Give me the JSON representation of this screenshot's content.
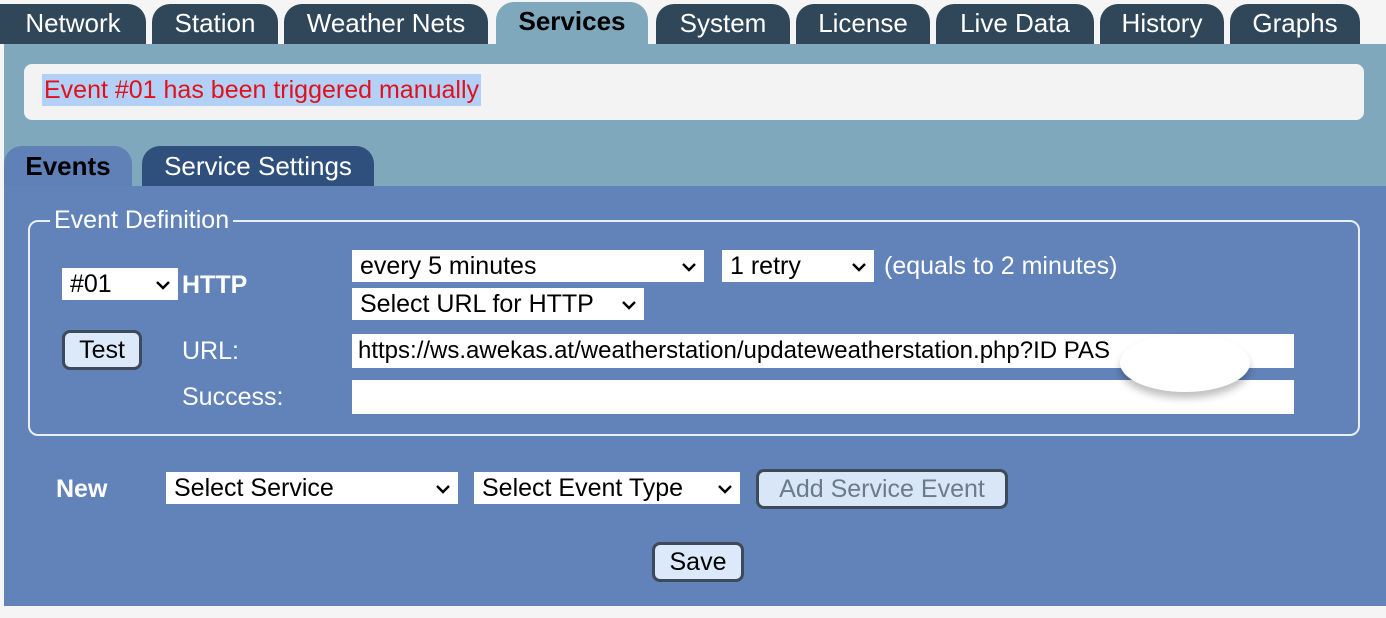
{
  "top_tabs": [
    {
      "label": "Network",
      "active": false
    },
    {
      "label": "Station",
      "active": false
    },
    {
      "label": "Weather Nets",
      "active": false
    },
    {
      "label": "Services",
      "active": true
    },
    {
      "label": "System",
      "active": false
    },
    {
      "label": "License",
      "active": false
    },
    {
      "label": "Live Data",
      "active": false
    },
    {
      "label": "History",
      "active": false
    },
    {
      "label": "Graphs",
      "active": false
    }
  ],
  "message": "Event #01 has been triggered manually",
  "sub_tabs": [
    {
      "label": "Events",
      "active": true
    },
    {
      "label": "Service Settings",
      "active": false
    }
  ],
  "event_definition": {
    "legend": "Event Definition",
    "event_number": "#01",
    "event_type": "HTTP",
    "interval": "every 5 minutes",
    "retry": "1 retry",
    "equals_note": "(equals to 2 minutes)",
    "url_select": "Select URL for HTTP",
    "test_label": "Test",
    "url_label": "URL:",
    "url_value": "https://ws.awekas.at/weatherstation/updateweatherstation.php?ID           PAS",
    "success_label": "Success:",
    "success_value": ""
  },
  "new_row": {
    "label": "New",
    "service_select": "Select Service",
    "event_type_select": "Select Event Type",
    "add_button": "Add Service Event"
  },
  "save_label": "Save",
  "colors": {
    "tab_dark": "#2f4759",
    "tab_active": "#7fa8bd",
    "panel": "#6283b9",
    "message_text": "#e0111b"
  }
}
